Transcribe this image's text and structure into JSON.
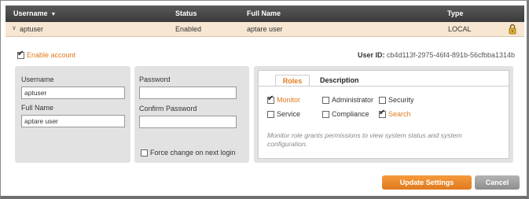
{
  "table": {
    "headers": {
      "username": "Username",
      "status": "Status",
      "full_name": "Full Name",
      "type": "Type"
    },
    "row": {
      "username": "aptuser",
      "status": "Enabled",
      "full_name": "aptare user",
      "type": "LOCAL"
    }
  },
  "details": {
    "enable_account": {
      "label": "Enable account",
      "checked": true
    },
    "user_id": {
      "label": "User ID:",
      "value": "cb4d113f-2975-46f4-891b-56cfbba1314b"
    },
    "username": {
      "label": "Username",
      "value": "aptuser"
    },
    "full_name": {
      "label": "Full Name",
      "value": "aptare user"
    },
    "password": {
      "label": "Password",
      "value": ""
    },
    "confirm_password": {
      "label": "Confirm Password",
      "value": ""
    },
    "force_change": {
      "label": "Force change on next login",
      "checked": false
    }
  },
  "roles": {
    "tabs": {
      "roles": "Roles",
      "description": "Description"
    },
    "items": {
      "monitor": {
        "label": "Monitor",
        "checked": true
      },
      "administrator": {
        "label": "Administrator",
        "checked": false
      },
      "security": {
        "label": "Security",
        "checked": false
      },
      "service": {
        "label": "Service",
        "checked": false
      },
      "compliance": {
        "label": "Compliance",
        "checked": false
      },
      "search": {
        "label": "Search",
        "checked": true
      }
    },
    "description": "Monitor role grants permissions to view system status and system configuration."
  },
  "buttons": {
    "update": "Update Settings",
    "cancel": "Cancel"
  },
  "colors": {
    "accent": "#e07a1f",
    "header_bg": "#3f3f3f",
    "row_bg": "#f7e6d2"
  }
}
